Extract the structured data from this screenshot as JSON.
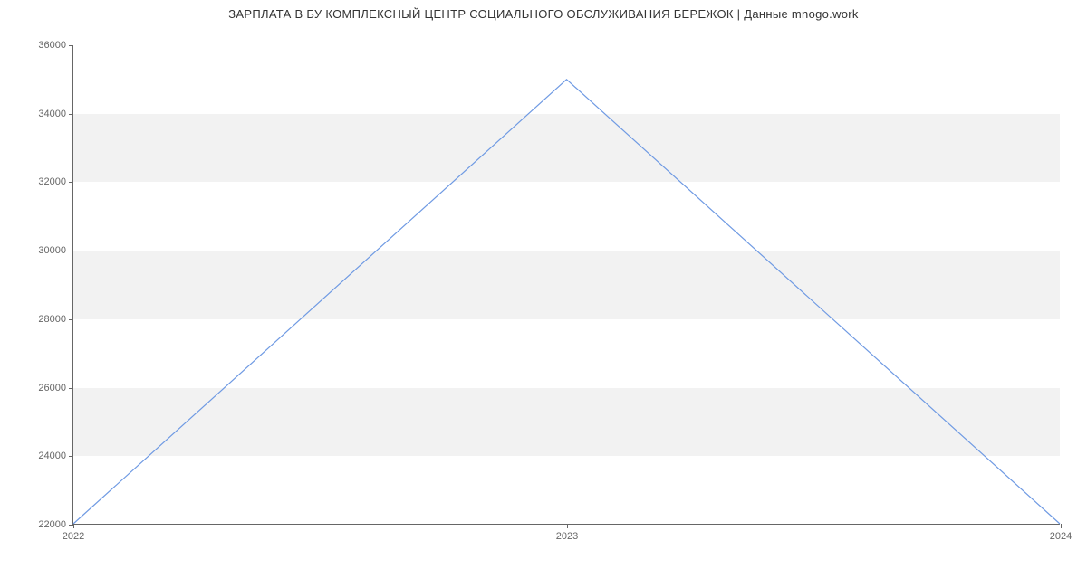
{
  "chart_data": {
    "type": "line",
    "title": "ЗАРПЛАТА В БУ КОМПЛЕКСНЫЙ ЦЕНТР СОЦИАЛЬНОГО ОБСЛУЖИВАНИЯ БЕРЕЖОК | Данные mnogo.work",
    "xlabel": "",
    "ylabel": "",
    "x": [
      2022,
      2023,
      2024
    ],
    "values": [
      22000,
      35000,
      22000
    ],
    "x_ticks": [
      2022,
      2023,
      2024
    ],
    "y_ticks": [
      22000,
      24000,
      26000,
      28000,
      30000,
      32000,
      34000,
      36000
    ],
    "xlim": [
      2022,
      2024
    ],
    "ylim": [
      22000,
      36000
    ],
    "line_color": "#6f9ae3"
  }
}
